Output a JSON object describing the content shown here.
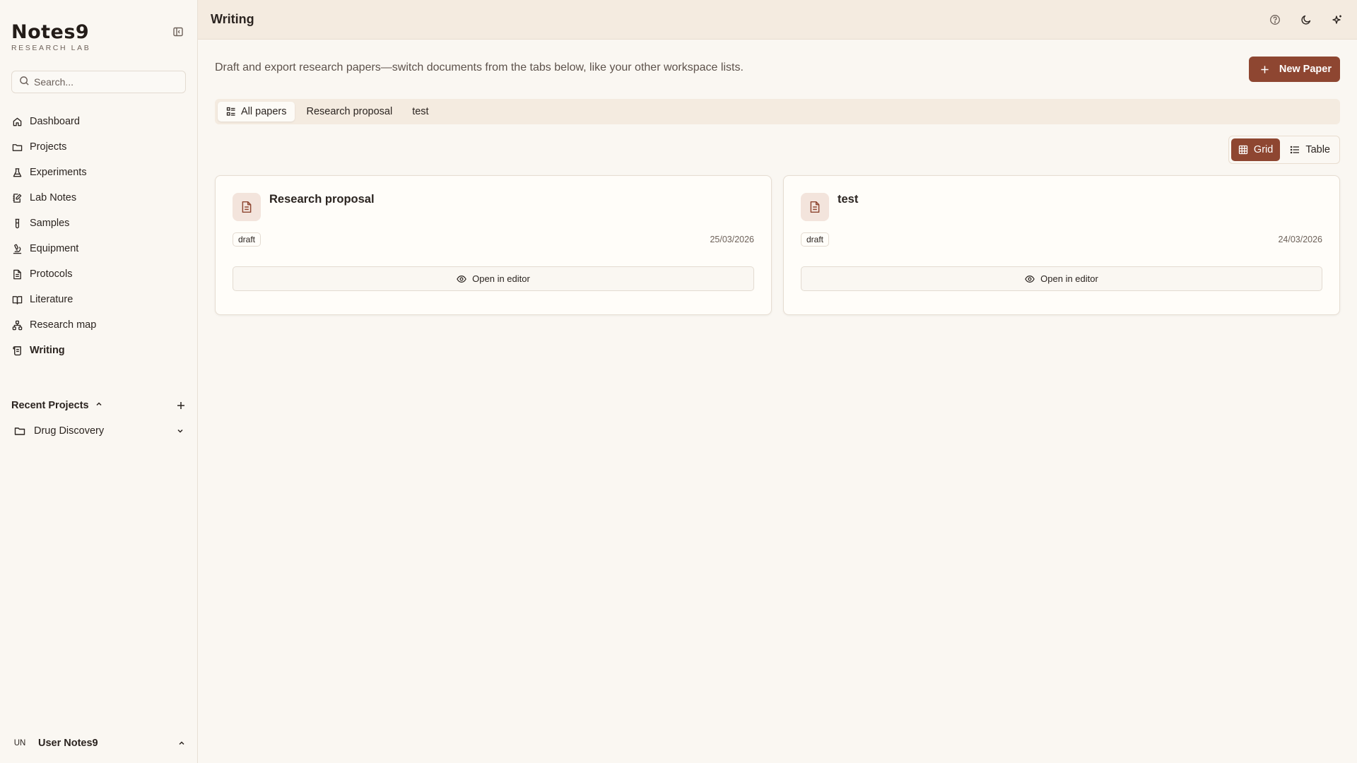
{
  "brand": {
    "name": "Notes9",
    "subtitle": "RESEARCH LAB"
  },
  "search": {
    "placeholder": "Search..."
  },
  "nav": {
    "items": [
      {
        "label": "Dashboard",
        "icon": "home-icon"
      },
      {
        "label": "Projects",
        "icon": "folder-icon"
      },
      {
        "label": "Experiments",
        "icon": "flask-icon"
      },
      {
        "label": "Lab Notes",
        "icon": "notebook-pen-icon"
      },
      {
        "label": "Samples",
        "icon": "test-tube-icon"
      },
      {
        "label": "Equipment",
        "icon": "microscope-icon"
      },
      {
        "label": "Protocols",
        "icon": "file-text-icon"
      },
      {
        "label": "Literature",
        "icon": "book-open-icon"
      },
      {
        "label": "Research map",
        "icon": "network-icon"
      },
      {
        "label": "Writing",
        "icon": "scroll-icon",
        "active": true
      }
    ]
  },
  "recent": {
    "title": "Recent Projects",
    "items": [
      {
        "label": "Drug Discovery"
      }
    ]
  },
  "user": {
    "initials": "UN",
    "name": "User Notes9"
  },
  "header": {
    "title": "Writing"
  },
  "main": {
    "intro": "Draft and export research papers—switch documents from the tabs below, like your other workspace lists.",
    "new_button": "New Paper",
    "tabs": [
      {
        "label": "All papers",
        "active": true
      },
      {
        "label": "Research proposal"
      },
      {
        "label": "test"
      }
    ],
    "view_toggle": {
      "grid": "Grid",
      "table": "Table",
      "selected": "Grid"
    },
    "papers": [
      {
        "title": "Research proposal",
        "status": "draft",
        "date": "25/03/2026",
        "action": "Open in editor"
      },
      {
        "title": "test",
        "status": "draft",
        "date": "24/03/2026",
        "action": "Open in editor"
      }
    ]
  },
  "colors": {
    "accent": "#8e4631",
    "background": "#faf7f2",
    "header": "#f4ebe0"
  }
}
